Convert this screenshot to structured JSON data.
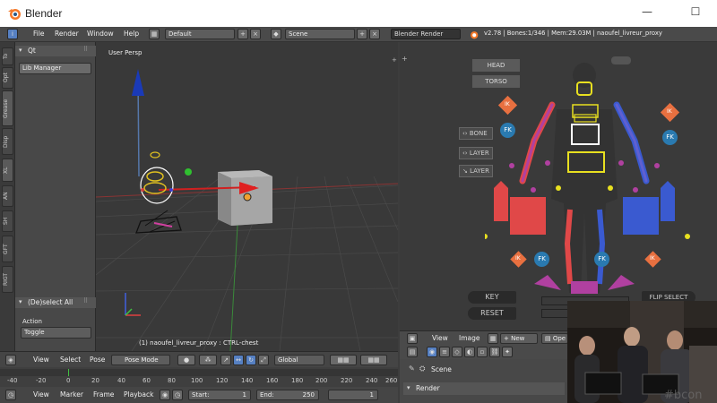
{
  "window": {
    "title": "Blender",
    "minimize": "—",
    "maximize": "☐"
  },
  "menu": {
    "items": [
      "File",
      "Render",
      "Window",
      "Help"
    ],
    "layout_field": "Default",
    "scene_field": "Scene",
    "engine": "Blender Render",
    "stats": "v2.78 | Bones:1/346 | Mem:29.03M | naoufel_livreur_proxy"
  },
  "left_tabs": [
    "To",
    "Opt",
    "Grease",
    "Disp",
    "XL",
    "AN",
    "SH",
    "GFT",
    "RIGT"
  ],
  "toolshelf": {
    "header": "Qt",
    "lib_manager": "Lib Manager",
    "op_title": "(De)select All",
    "action_label": "Action",
    "action_value": "Toggle"
  },
  "viewport": {
    "label": "User Persp",
    "status": "(1) naoufel_livreur_proxy : CTRL-chest"
  },
  "picker": {
    "head": "HEAD",
    "torso": "TORSO",
    "bone": "BONE",
    "layer1": "LAYER",
    "layer2": "LAYER",
    "ik": "IK",
    "fk": "FK",
    "key": "KEY",
    "reset": "RESET",
    "flip_select": "FLIP SELECT"
  },
  "image_editor_bar": {
    "view": "View",
    "image": "Image",
    "new_btn": "New",
    "open_btn": "Ope"
  },
  "properties": {
    "scene": "Scene",
    "render": "Render"
  },
  "vp_toolbar": {
    "view": "View",
    "select": "Select",
    "pose": "Pose",
    "mode": "Pose Mode",
    "orientation": "Global"
  },
  "timeline": {
    "ticks": [
      "-40",
      "-20",
      "0",
      "20",
      "40",
      "60",
      "80",
      "100",
      "120",
      "140",
      "160",
      "180",
      "200",
      "220",
      "240",
      "260"
    ],
    "view": "View",
    "marker": "Marker",
    "frame": "Frame",
    "playback": "Playback",
    "start_label": "Start:",
    "start_value": "1",
    "end_label": "End:",
    "end_value": "250",
    "current": "1"
  },
  "webcam": {
    "watermark": "#bcon"
  },
  "colors": {
    "accent_blue": "#5680c2",
    "selected_orange": "#f0a030",
    "picker_red": "#e04848",
    "picker_blue": "#3a5ad0",
    "picker_purple": "#b040a0",
    "picker_yellow": "#e8e020",
    "ik_orange": "#e87040",
    "fk_blue": "#2a7ab0"
  }
}
